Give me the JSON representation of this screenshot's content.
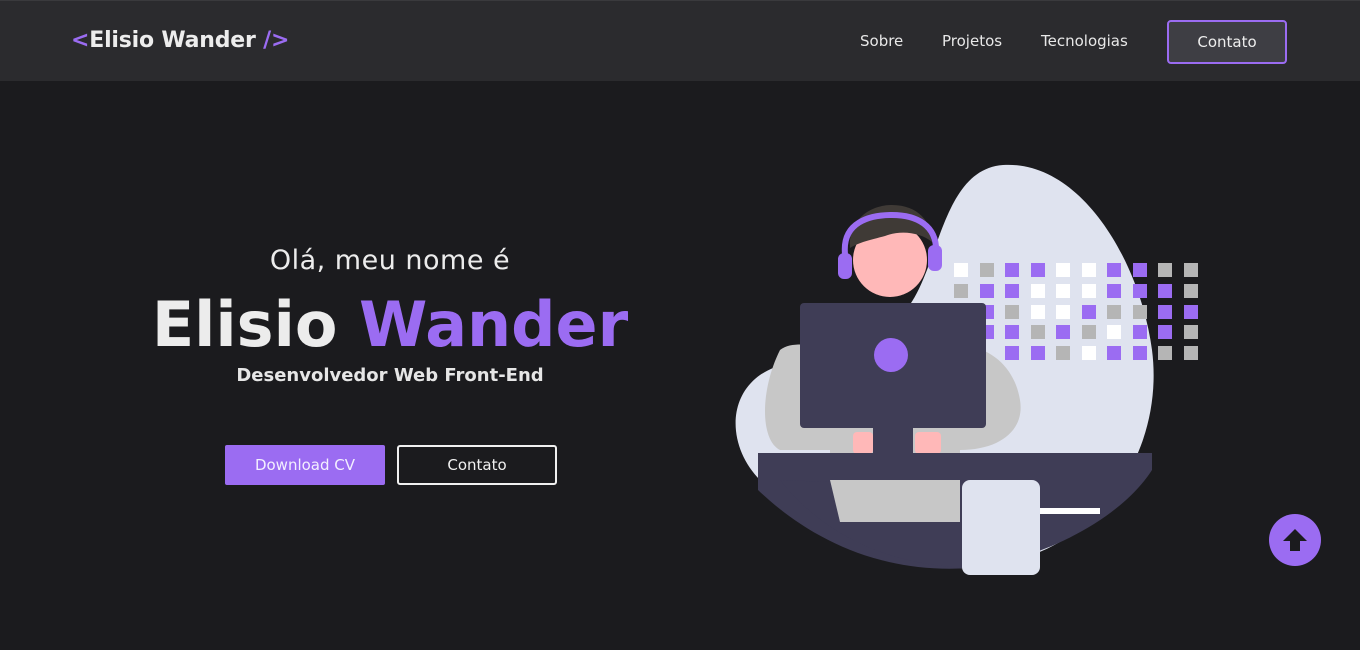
{
  "navbar": {
    "logo": {
      "open": "<",
      "name": "Elisio Wander",
      "close": " />"
    },
    "links": [
      "Sobre",
      "Projetos",
      "Tecnologias"
    ],
    "contact_button": "Contato"
  },
  "hero": {
    "greeting": "Olá, meu nome é",
    "first_name": "Elisio",
    "last_name": "Wander",
    "role": "Desenvolvedor Web Front-End",
    "download_button": "Download CV",
    "contact_button": "Contato"
  },
  "illustration": {
    "subject": "developer with headset at laptop"
  },
  "scroll_top": {
    "icon": "arrow-up-icon"
  },
  "colors": {
    "accent": "#9b6cf2",
    "background": "#1b1b1e",
    "navbar": "#2b2b2e",
    "text": "#ececec"
  }
}
